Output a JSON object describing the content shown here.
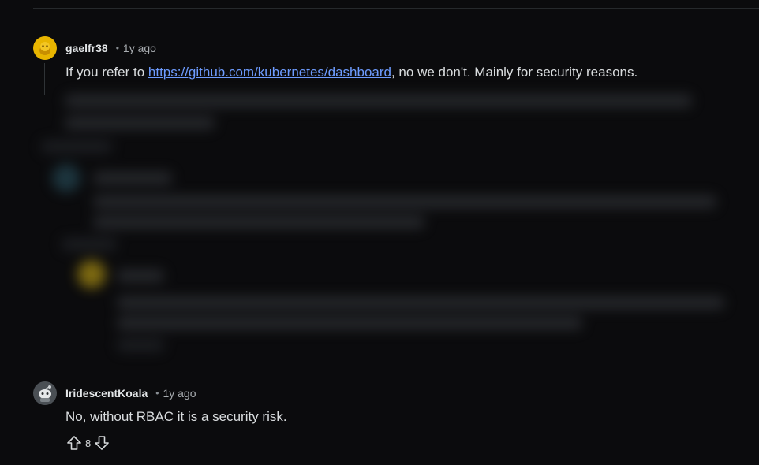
{
  "comments": [
    {
      "author": "gaelfr38",
      "separator": "•",
      "time": "1y ago",
      "text_before": "If you refer to ",
      "link": "https://github.com/kubernetes/dashboard",
      "text_after": ", no we don't. Mainly for security reasons."
    },
    {
      "author": "IridescentKoala",
      "separator": "•",
      "time": "1y ago",
      "text": "No, without RBAC it is a security risk.",
      "votes": "8"
    }
  ],
  "icons": {
    "avatar1": "snoo-avatar-icon",
    "avatar2": "snoo-avatar-icon",
    "upvote": "upvote-arrow-icon",
    "downvote": "downvote-arrow-icon"
  },
  "colors": {
    "background": "#0b0b0d",
    "link": "#6e9cff",
    "avatar_gold": "#e8b500"
  }
}
